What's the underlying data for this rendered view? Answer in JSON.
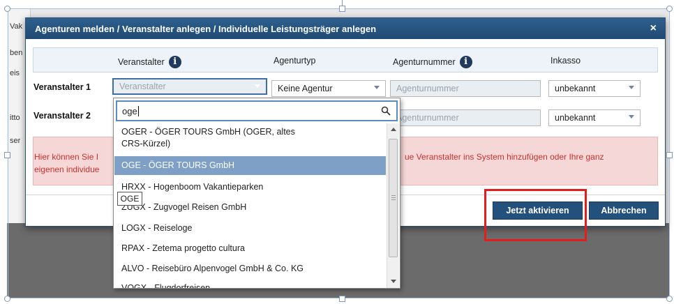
{
  "modal": {
    "title": "Agenturen melden / Veranstalter anlegen / Individuelle Leistungsträger anlegen",
    "close": "×"
  },
  "columns": {
    "veranstalter": "Veranstalter",
    "agenturtyp": "Agenturtyp",
    "agenturnummer": "Agenturnummer",
    "inkasso": "Inkasso",
    "info_glyph": "i"
  },
  "rows": [
    {
      "label": "Veranstalter 1",
      "veranstalter_placeholder": "Veranstalter",
      "agenturtyp": "Keine Agentur",
      "agenturnummer_placeholder": "Agenturnummer",
      "inkasso": "unbekannt"
    },
    {
      "label": "Veranstalter 2",
      "agenturnummer_placeholder": "Agenturnummer",
      "inkasso": "unbekannt"
    }
  ],
  "info": {
    "left_line1": "Hier können Sie I",
    "left_line2": "eigenen individue",
    "right_line1": "ue Veranstalter ins System hinzufügen oder Ihre ganz"
  },
  "buttons": {
    "activate": "Jetzt aktivieren",
    "cancel": "Abbrechen"
  },
  "dropdown": {
    "search_value": "oge",
    "items": [
      "OGER - ÖGER TOURS GmbH (OGER, altes",
      "CRS-Kürzel)",
      "OGE - ÖGER TOURS GmbH",
      "HRXX - Hogenboom Vakantieparken",
      "ZUGX - Zugvogel Reisen GmbH",
      "LOGX - Reiseloge",
      "RPAX - Zetema progetto cultura",
      "ALVO - Reisebüro Alpenvogel GmbH & Co. KG",
      "VOGX - Flugdorfreisen"
    ],
    "tooltip": "OGE"
  },
  "background": {
    "t1": "Vak",
    "t2": "ben",
    "t3": "eis",
    "t4": "itto",
    "t5": "ser"
  },
  "colors": {
    "header": "#2f5f8d",
    "button": "#24507c",
    "selected_item": "#7fa0c6",
    "info_bg": "#f6d7d7",
    "info_text": "#c9302c",
    "highlight": "#e41c1c"
  }
}
